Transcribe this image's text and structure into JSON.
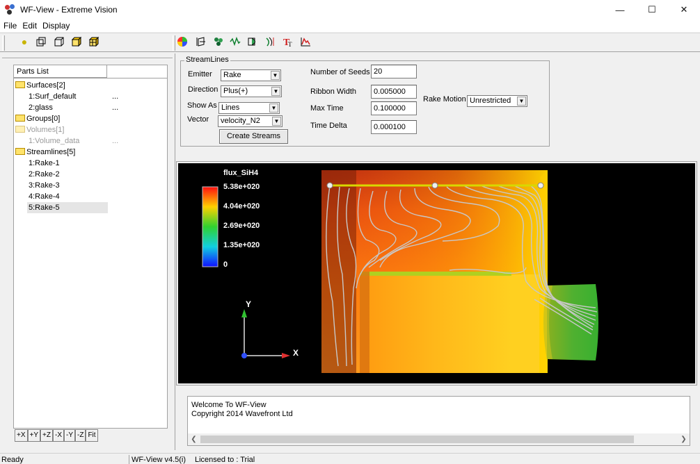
{
  "window": {
    "title": "WF-View - Extreme Vision"
  },
  "menu": {
    "items": [
      "File",
      "Edit",
      "Display"
    ]
  },
  "parts_list": {
    "header": "Parts List",
    "items": [
      {
        "label": "Surfaces[2]",
        "folder": true
      },
      {
        "label": "1:Surf_default",
        "dots": "..."
      },
      {
        "label": "2:glass",
        "dots": "..."
      },
      {
        "label": "Groups[0]",
        "folder": true
      },
      {
        "label": "Volumes[1]",
        "folder": true
      },
      {
        "label": "1:Volume_data",
        "dots": "..."
      },
      {
        "label": "Streamlines[5]",
        "folder": true
      },
      {
        "label": "1:Rake-1"
      },
      {
        "label": "2:Rake-2"
      },
      {
        "label": "3:Rake-3"
      },
      {
        "label": "4:Rake-4"
      },
      {
        "label": "5:Rake-5"
      }
    ],
    "view_buttons": [
      "+X",
      "+Y",
      "+Z",
      "-X",
      "-Y",
      "-Z",
      "Fit"
    ]
  },
  "streamlines": {
    "legend": "StreamLines",
    "emitter_label": "Emitter",
    "emitter_value": "Rake",
    "direction_label": "Direction",
    "direction_value": "Plus(+)",
    "showas_label": "Show As",
    "showas_value": "Lines",
    "vector_label": "Vector",
    "vector_value": "velocity_N2",
    "create_button": "Create Streams",
    "seeds_label": "Number of Seeds",
    "seeds_value": "20",
    "ribbon_label": "Ribbon Width",
    "ribbon_value": "0.005000",
    "maxtime_label": "Max Time",
    "maxtime_value": "0.100000",
    "timedelta_label": "Time Delta",
    "timedelta_value": "0.000100",
    "rakemotion_label": "Rake Motion",
    "rakemotion_value": "Unrestricted"
  },
  "viewport": {
    "colorbar_title": "flux_SiH4",
    "colorbar_labels": [
      "5.38e+020",
      "4.04e+020",
      "2.69e+020",
      "1.35e+020",
      "0"
    ],
    "axis_y": "Y",
    "axis_x": "X"
  },
  "console": {
    "lines": [
      "Welcome To WF-View",
      "Copyright 2014 Wavefront Ltd"
    ]
  },
  "status": {
    "left": "Ready",
    "version": "WF-View v4.5(i)",
    "license": "Licensed to : Trial"
  },
  "colors": {
    "selection": "#e5e5e5",
    "rake_line": "#d8d800",
    "streamline": "#c8c8c8"
  }
}
